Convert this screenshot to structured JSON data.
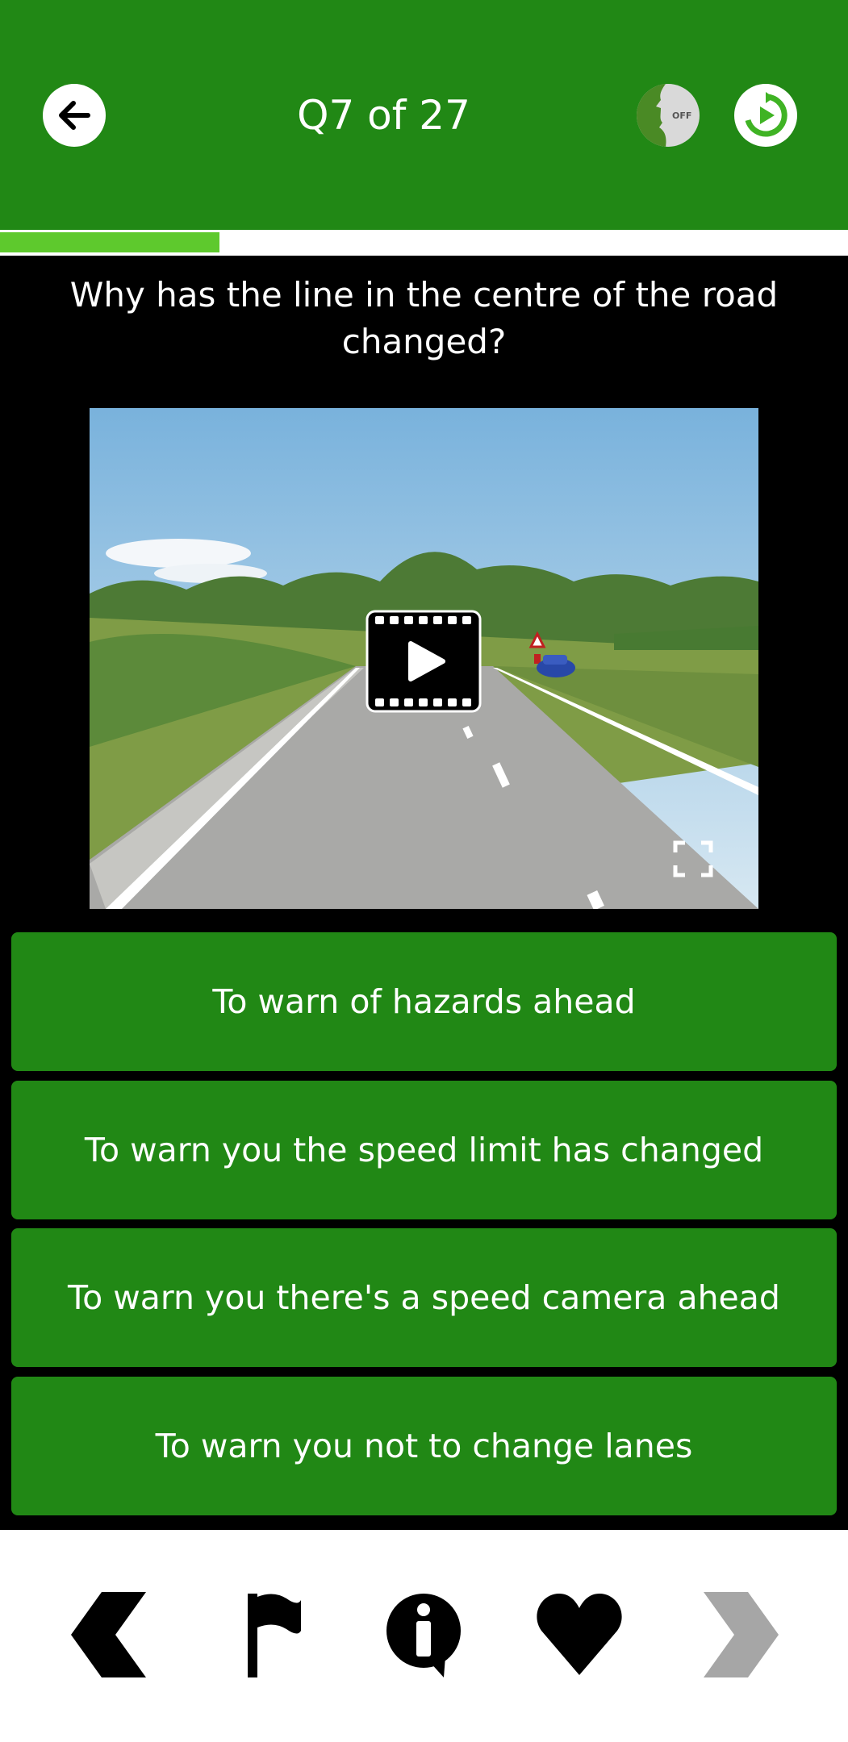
{
  "header": {
    "title": "Q7 of 27",
    "voice_status": "OFF",
    "back_icon": "arrow-left-icon",
    "voice_icon": "voice-face-icon",
    "replay_icon": "replay-icon"
  },
  "progress": {
    "current": 7,
    "total": 27,
    "fraction": 0.259
  },
  "question": {
    "text": "Why has the line in the centre of the road changed?"
  },
  "media": {
    "type": "video",
    "play_icon": "play-film-icon",
    "fullscreen_icon": "fullscreen-icon"
  },
  "answers": [
    {
      "label": "To warn of hazards ahead"
    },
    {
      "label": "To warn you the speed limit has changed"
    },
    {
      "label": "To warn you there's a speed camera ahead"
    },
    {
      "label": "To warn you not to change lanes"
    }
  ],
  "bottom_nav": {
    "items": [
      {
        "icon": "chevron-left-icon"
      },
      {
        "icon": "flag-icon"
      },
      {
        "icon": "info-icon"
      },
      {
        "icon": "heart-icon"
      },
      {
        "icon": "chevron-right-icon"
      }
    ]
  },
  "colors": {
    "primary_green": "#218815",
    "progress_green": "#5ec92d",
    "background_black": "#000000",
    "disabled_gray": "#a6a6a6"
  }
}
